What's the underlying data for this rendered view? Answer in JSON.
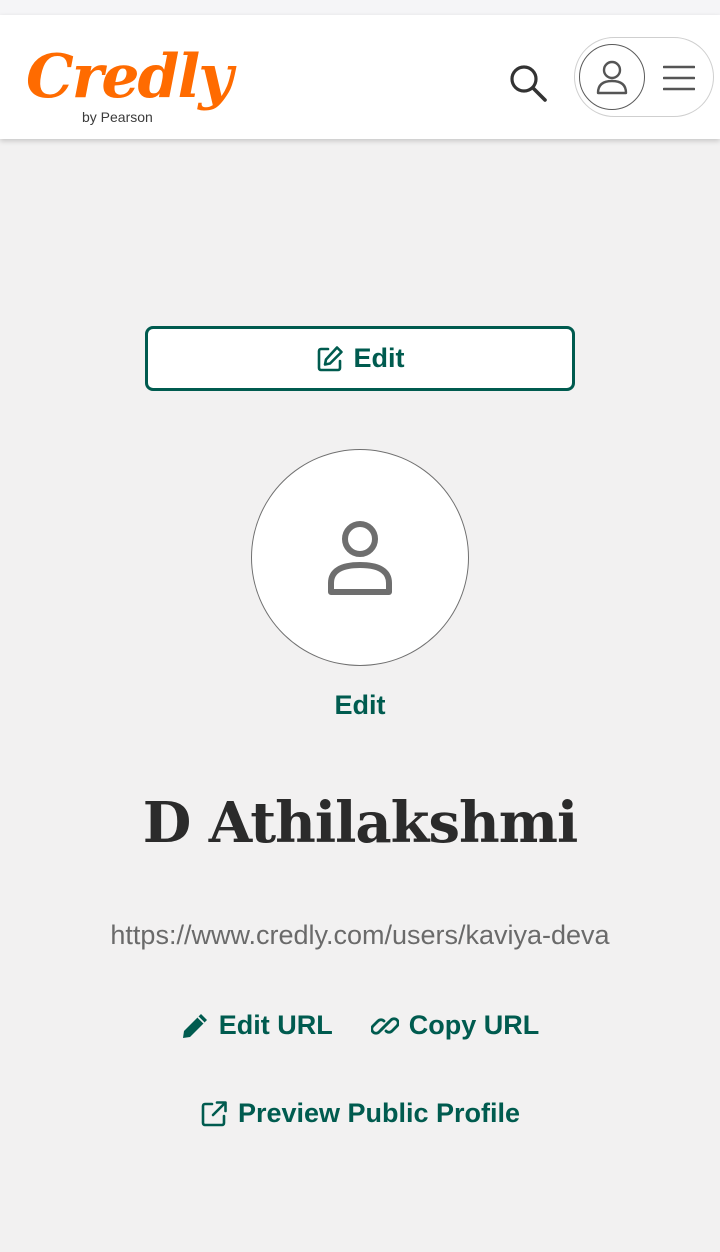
{
  "header": {
    "logo_text": "Credly",
    "logo_sub": "by Pearson",
    "search_icon": "search-icon",
    "user_icon": "user-icon",
    "menu_icon": "hamburger-menu-icon"
  },
  "profile": {
    "edit_cover_label": "Edit",
    "edit_avatar_label": "Edit",
    "name": "D Athilakshmi",
    "url": "https://www.credly.com/users/kaviya-deva",
    "edit_url_label": "Edit URL",
    "copy_url_label": "Copy URL",
    "preview_label": "Preview Public Profile"
  },
  "colors": {
    "brand": "#ff6b00",
    "accent": "#005b4f",
    "background": "#f2f1f1"
  }
}
